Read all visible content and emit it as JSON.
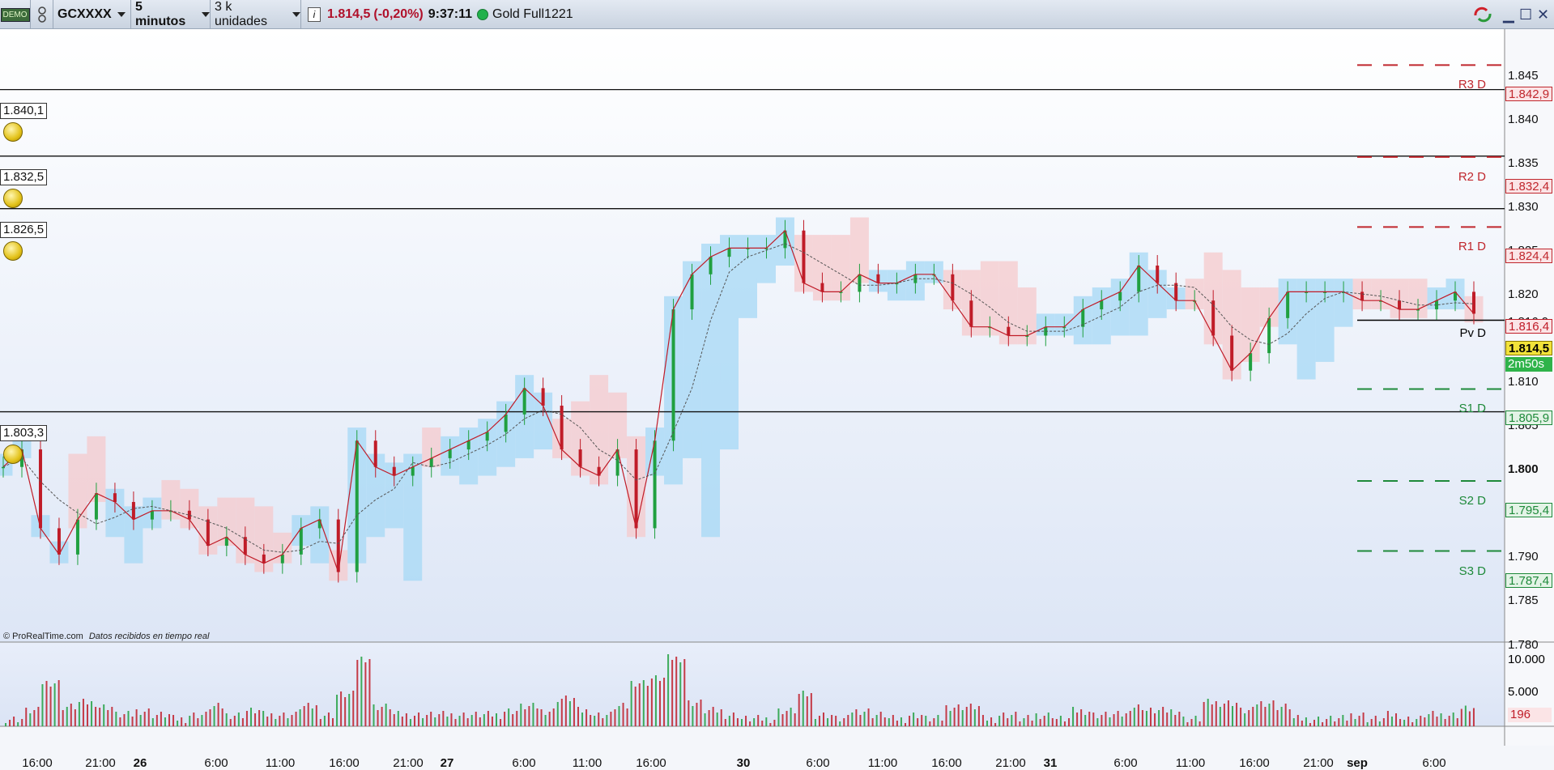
{
  "toolbar": {
    "demo_badge": "DEMO",
    "symbol": "GCXXXX",
    "timeframe": "5 minutos",
    "units": "3 k unidades",
    "price": "1.814,5",
    "change": "(-0,20%)",
    "time": "9:37:11",
    "instrument": "Gold Full1221"
  },
  "chart_data": {
    "type": "line",
    "title": "",
    "price_axis_ticks": [
      "1.845",
      "1.840",
      "1.835",
      "1.830",
      "1.825",
      "1.820",
      "1.816,9",
      "1.810",
      "1.805",
      "1.800",
      "1.795",
      "1.790",
      "1.785",
      "1.780"
    ],
    "volume_axis_ticks": [
      "10.000",
      "5.000"
    ],
    "volume_last": "196",
    "x_ticks": [
      "16:00",
      "21:00",
      "26",
      "6:00",
      "11:00",
      "16:00",
      "21:00",
      "27",
      "6:00",
      "11:00",
      "16:00",
      "30",
      "6:00",
      "11:00",
      "16:00",
      "21:00",
      "31",
      "6:00",
      "11:00",
      "16:00",
      "21:00",
      "sep",
      "6:00"
    ],
    "horizontal_levels": [
      {
        "label": "1.840,1",
        "value": 1840.1
      },
      {
        "label": "1.832,5",
        "value": 1832.5
      },
      {
        "label": "1.826,5",
        "value": 1826.5
      },
      {
        "label": "1.803,3",
        "value": 1803.3
      }
    ],
    "pivots": [
      {
        "name": "R3 D",
        "label": "1.842,9",
        "value": 1842.9,
        "color": "#c0272d"
      },
      {
        "name": "R2 D",
        "label": "1.832,4",
        "value": 1832.4,
        "color": "#c0272d"
      },
      {
        "name": "R1 D",
        "label": "1.824,4",
        "value": 1824.4,
        "color": "#c0272d"
      },
      {
        "name": "Pv D",
        "label": "1.814,5",
        "value": 1814.5,
        "color": "#000000"
      },
      {
        "name": "S1 D",
        "label": "1.805,9",
        "value": 1805.9,
        "color": "#1e8a3a"
      },
      {
        "name": "S2 D",
        "label": "1.795,4",
        "value": 1795.4,
        "color": "#1e8a3a"
      },
      {
        "name": "S3 D",
        "label": "1.787,4",
        "value": 1787.4,
        "color": "#1e8a3a"
      }
    ],
    "current_price_label": "1.814,5",
    "extra_tag": "1.816,4",
    "countdown": "2m50s",
    "price_series": [
      1797,
      1799,
      1790,
      1787,
      1791,
      1794,
      1793,
      1791,
      1792,
      1792,
      1791,
      1788,
      1789,
      1787,
      1786,
      1787,
      1790,
      1791,
      1785,
      1800,
      1797,
      1796,
      1797,
      1798,
      1799,
      1800,
      1801,
      1803,
      1806,
      1804,
      1799,
      1797,
      1796,
      1799,
      1790,
      1800,
      1815,
      1819,
      1821,
      1822,
      1822,
      1822,
      1824,
      1818,
      1817,
      1817,
      1819,
      1818,
      1818,
      1819,
      1819,
      1816,
      1813,
      1813,
      1812,
      1812,
      1813,
      1813,
      1815,
      1816,
      1817,
      1820,
      1818,
      1816,
      1816,
      1812,
      1808,
      1810,
      1814,
      1817,
      1817,
      1817,
      1817,
      1816,
      1816,
      1815,
      1815,
      1816,
      1817,
      1814.5
    ],
    "colors": {
      "up": "#20a040",
      "down": "#c01c28",
      "cloud_bull": "#a6d8f5",
      "cloud_bear": "#f6c9cc",
      "price_tag": "#f2e23a"
    }
  },
  "footer": {
    "copyright": "© ProRealTime.com",
    "realtime_note": "Datos recibidos en tiempo real"
  }
}
